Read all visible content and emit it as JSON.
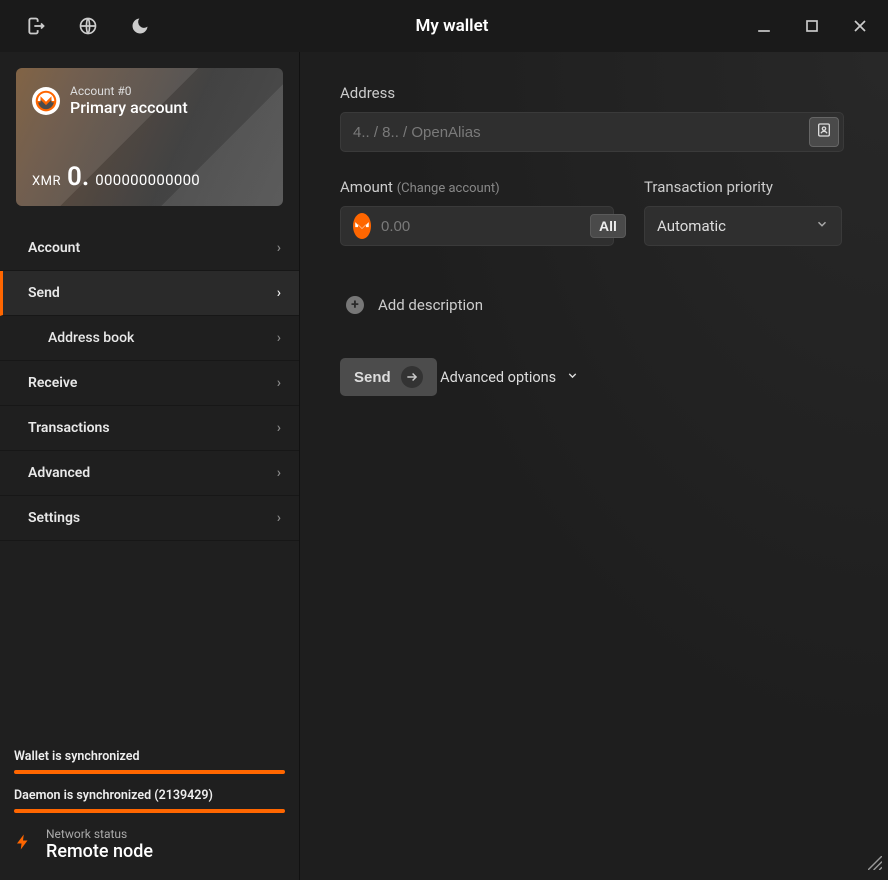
{
  "title": "My wallet",
  "account_card": {
    "subtitle": "Account #0",
    "name": "Primary account",
    "currency": "XMR",
    "balance_int": "0.",
    "balance_dec": "000000000000"
  },
  "nav": {
    "account": "Account",
    "send": "Send",
    "address_book": "Address book",
    "receive": "Receive",
    "transactions": "Transactions",
    "advanced": "Advanced",
    "settings": "Settings"
  },
  "status": {
    "wallet_sync": "Wallet is synchronized",
    "daemon_sync": "Daemon is synchronized (2139429)",
    "network_label": "Network status",
    "network_value": "Remote node"
  },
  "form": {
    "address_label": "Address",
    "address_placeholder": "4.. / 8.. / OpenAlias",
    "amount_label": "Amount",
    "amount_sub": "(Change account)",
    "amount_placeholder": "0.00",
    "all_button": "All",
    "priority_label": "Transaction priority",
    "priority_value": "Automatic",
    "add_description": "Add description",
    "send_button": "Send",
    "advanced_options": "Advanced options"
  }
}
